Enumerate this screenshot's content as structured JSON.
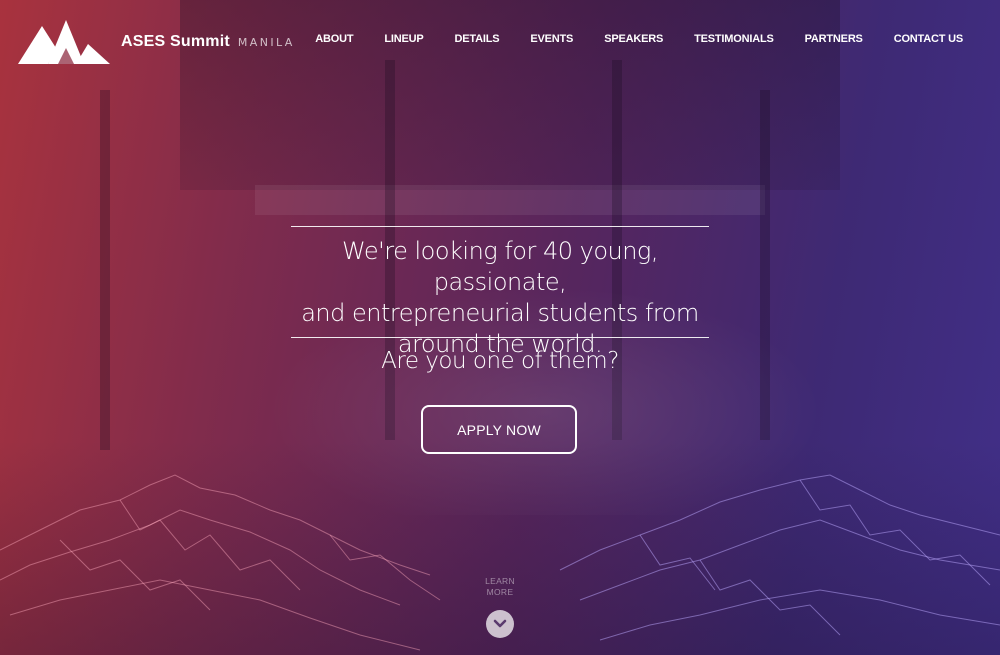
{
  "brand": {
    "name": "ASES Summit",
    "city": "MANILA",
    "logo_icon": "mountain-peaks-icon"
  },
  "nav": {
    "items": [
      "ABOUT",
      "LINEUP",
      "DETAILS",
      "EVENTS",
      "SPEAKERS",
      "TESTIMONIALS",
      "PARTNERS",
      "CONTACT US"
    ]
  },
  "hero": {
    "headline_lines": [
      "We're looking for 40 young, passionate,",
      "and entrepreneurial students from",
      "around the world."
    ],
    "question": "Are you one of them?",
    "cta_label": "APPLY NOW",
    "learn_more_lines": [
      "LEARN",
      "MORE"
    ],
    "scroll_icon": "chevron-down-icon"
  },
  "colors": {
    "gradient_left": "#b2343c",
    "gradient_right": "#42308c",
    "text": "#ffffff"
  }
}
